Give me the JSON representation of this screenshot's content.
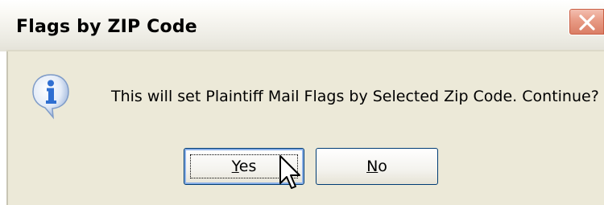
{
  "window": {
    "title": "Flags by ZIP Code",
    "close_icon": "close-icon"
  },
  "dialog": {
    "icon": "info-icon",
    "message": "This will set Plaintiff Mail Flags by Selected Zip Code. Continue?",
    "buttons": {
      "yes": {
        "mnemonic": "Y",
        "rest": "es",
        "focused": true
      },
      "no": {
        "mnemonic": "N",
        "rest": "o"
      }
    }
  },
  "cursor": {
    "icon": "pointer-cursor-icon"
  },
  "colors": {
    "dialog_bg": "#ece9d8",
    "close_button": "#e38a70",
    "button_border": "#003c74",
    "info_blue": "#2f6fd1"
  }
}
